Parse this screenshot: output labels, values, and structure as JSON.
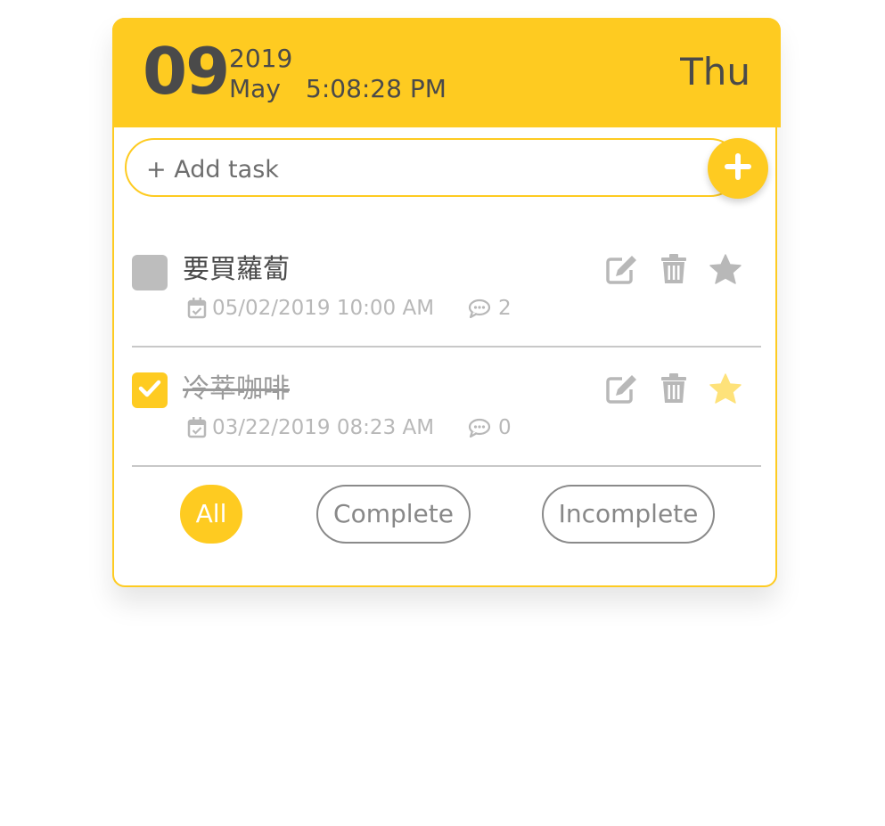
{
  "header": {
    "day": "09",
    "year": "2019",
    "month": "May",
    "time": "5:08:28 PM",
    "weekday": "Thu"
  },
  "add_task": {
    "placeholder": "+ Add task",
    "button_icon": "plus-icon"
  },
  "tasks": [
    {
      "title": "要買蘿蔔",
      "completed": false,
      "starred": false,
      "date": "05/02/2019 10:00 AM",
      "comments": "2"
    },
    {
      "title": "冷萃咖啡",
      "completed": true,
      "starred": true,
      "date": "03/22/2019 08:23 AM",
      "comments": "0"
    }
  ],
  "filters": {
    "all": "All",
    "complete": "Complete",
    "incomplete": "Incomplete",
    "active": "all"
  },
  "colors": {
    "accent": "#fecb21",
    "text_dark": "#4a4a4a",
    "icon_gray": "#b8b8b8",
    "star_active": "#fee27a"
  },
  "icons": {
    "edit": "edit-icon",
    "delete": "trash-icon",
    "star": "star-icon",
    "calendar": "calendar-icon",
    "comment": "comment-icon",
    "check": "check-icon"
  }
}
